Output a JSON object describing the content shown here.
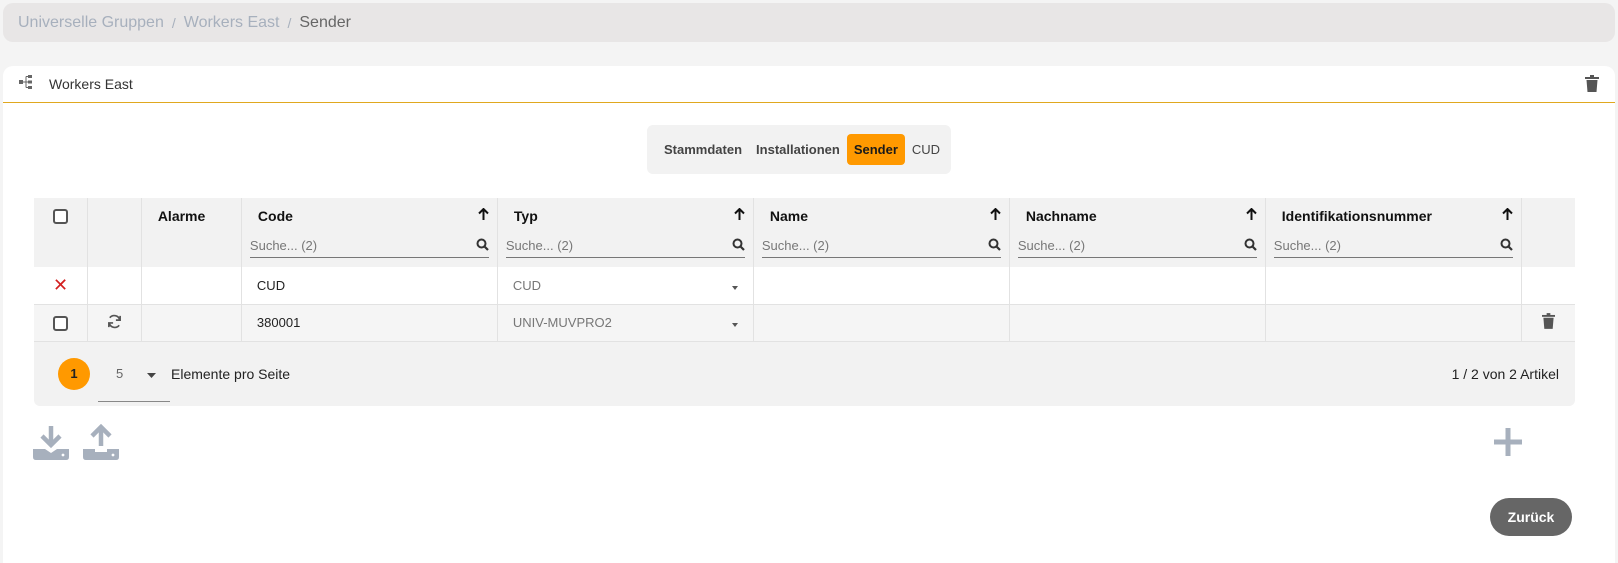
{
  "breadcrumb": {
    "items": [
      "Universelle Gruppen",
      "Workers East"
    ],
    "separator": "/",
    "current": "Sender"
  },
  "card": {
    "title": "Workers East"
  },
  "tabs": [
    {
      "label": "Stammdaten",
      "active": false
    },
    {
      "label": "Installationen",
      "active": false
    },
    {
      "label": "Sender",
      "active": true
    },
    {
      "label": "CUD",
      "active": false
    }
  ],
  "table": {
    "columns": [
      {
        "label": "Alarme",
        "sortable": false
      },
      {
        "label": "Code",
        "sortable": true,
        "filter_placeholder": "Suche... (2)"
      },
      {
        "label": "Typ",
        "sortable": true,
        "filter_placeholder": "Suche... (2)"
      },
      {
        "label": "Name",
        "sortable": true,
        "filter_placeholder": "Suche... (2)"
      },
      {
        "label": "Nachname",
        "sortable": true,
        "filter_placeholder": "Suche... (2)"
      },
      {
        "label": "Identifikationsnummer",
        "sortable": true,
        "filter_placeholder": "Suche... (2)"
      }
    ],
    "rows": [
      {
        "code": "CUD",
        "typ": "CUD",
        "name": "",
        "nachname": "",
        "id": ""
      },
      {
        "code": "380001",
        "typ": "UNIV-MUVPRO2",
        "name": "",
        "nachname": "",
        "id": ""
      }
    ]
  },
  "pager": {
    "page": "1",
    "page_size": "5",
    "per_page_label": "Elemente pro Seite",
    "count": "1 / 2 von 2 Artikel"
  },
  "actions": {
    "back_label": "Zurück"
  },
  "colors": {
    "accent": "#ff9900",
    "header_line": "#e0a81f",
    "icon_gray": "#a7b0bd",
    "delete_red": "#d32020"
  }
}
